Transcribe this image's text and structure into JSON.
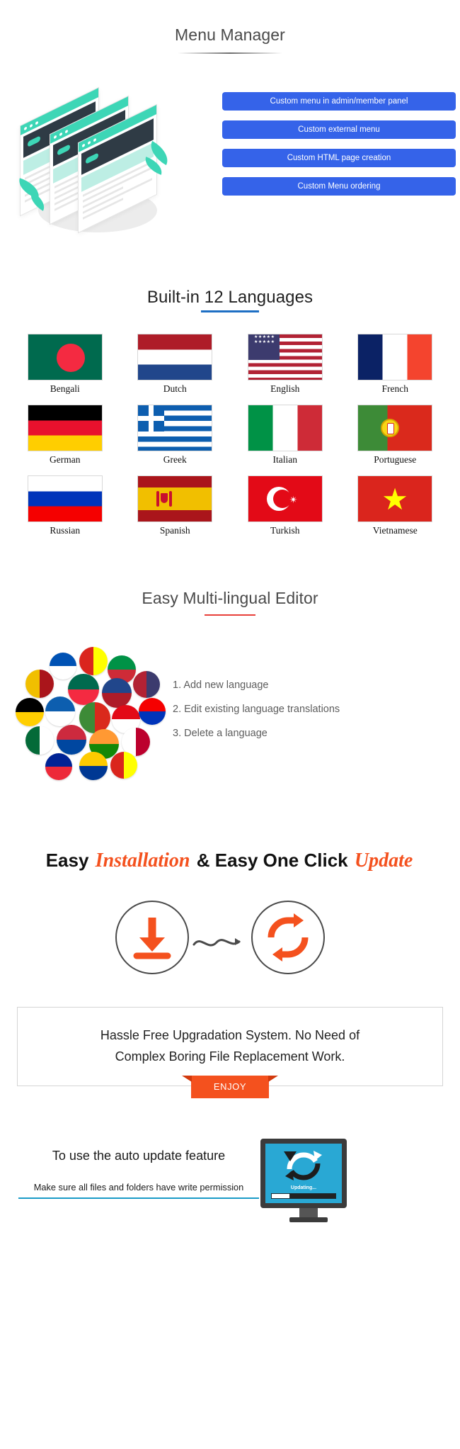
{
  "menu_manager": {
    "title": "Menu Manager",
    "buttons": [
      "Custom menu in admin/member panel",
      "Custom external menu",
      "Custom HTML page creation",
      "Custom Menu ordering"
    ],
    "button_color": "#3563e9"
  },
  "languages": {
    "title": "Built-in 12 Languages",
    "underline_color": "#1e6fc4",
    "items": [
      {
        "name": "Bengali",
        "flag": "bengali-flag"
      },
      {
        "name": "Dutch",
        "flag": "dutch-flag"
      },
      {
        "name": "English",
        "flag": "english-flag"
      },
      {
        "name": "French",
        "flag": "french-flag"
      },
      {
        "name": "German",
        "flag": "german-flag"
      },
      {
        "name": "Greek",
        "flag": "greek-flag"
      },
      {
        "name": "Italian",
        "flag": "italian-flag"
      },
      {
        "name": "Portuguese",
        "flag": "portuguese-flag"
      },
      {
        "name": "Russian",
        "flag": "russian-flag"
      },
      {
        "name": "Spanish",
        "flag": "spanish-flag"
      },
      {
        "name": "Turkish",
        "flag": "turkish-flag"
      },
      {
        "name": "Vietnamese",
        "flag": "vietnamese-flag"
      }
    ]
  },
  "editor": {
    "title": "Easy Multi-lingual Editor",
    "underline_color": "#e8403a",
    "list": [
      "1. Add new language",
      "2. Edit existing language translations",
      "3. Delete a language"
    ]
  },
  "install": {
    "title_part1": "Easy ",
    "title_script1": "Installation",
    "title_part2": " & Easy One Click ",
    "title_script2": "Update",
    "accent_color": "#f4511e",
    "box_line1": "Hassle Free Upgradation System. No Need of",
    "box_line2": "Complex Boring File Replacement Work.",
    "enjoy_label": "ENJOY",
    "download_icon": "download-icon",
    "refresh_icon": "refresh-icon"
  },
  "footer": {
    "heading": "To use the auto update feature",
    "subtext": "Make sure all files and folders have write permission",
    "underline_color": "#1a9bc7",
    "monitor_status": "Updating..."
  }
}
